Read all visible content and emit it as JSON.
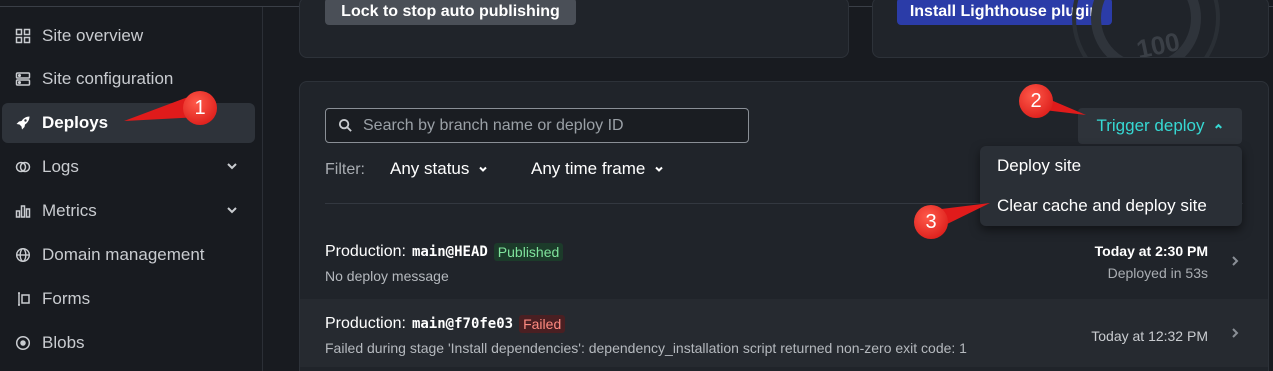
{
  "sidebar": {
    "items": [
      {
        "label": "Site overview",
        "icon": "grid-icon",
        "active": false,
        "has_chevron": false
      },
      {
        "label": "Site configuration",
        "icon": "server-icon",
        "active": false,
        "has_chevron": false
      },
      {
        "label": "Deploys",
        "icon": "rocket-icon",
        "active": true,
        "has_chevron": false
      },
      {
        "label": "Logs",
        "icon": "logs-icon",
        "active": false,
        "has_chevron": true
      },
      {
        "label": "Metrics",
        "icon": "chart-icon",
        "active": false,
        "has_chevron": true
      },
      {
        "label": "Domain management",
        "icon": "globe-icon",
        "active": false,
        "has_chevron": false
      },
      {
        "label": "Forms",
        "icon": "forms-icon",
        "active": false,
        "has_chevron": false
      },
      {
        "label": "Blobs",
        "icon": "blobs-icon",
        "active": false,
        "has_chevron": false
      }
    ]
  },
  "top_cards": {
    "lock_button": "Lock to stop auto publishing",
    "lighthouse_button": "Install Lighthouse plugin",
    "lighthouse_score": "100"
  },
  "deploys": {
    "search_placeholder": "Search by branch name or deploy ID",
    "filter_label": "Filter:",
    "status_filter": "Any status",
    "time_filter": "Any time frame",
    "trigger_label": "Trigger deploy",
    "trigger_menu": [
      "Deploy site",
      "Clear cache and deploy site"
    ],
    "rows": [
      {
        "prefix": "Production:",
        "ref": "main@HEAD",
        "badge": "Published",
        "message": "No deploy message",
        "time": "Today at 2:30 PM",
        "duration": "Deployed in 53s"
      },
      {
        "prefix": "Production:",
        "ref": "main@f70fe03",
        "badge": "Failed",
        "message": "Failed during stage 'Install dependencies': dependency_installation script returned non-zero exit code: 1",
        "time": "Today at 12:32 PM"
      }
    ]
  },
  "annotations": [
    "1",
    "2",
    "3"
  ],
  "colors": {
    "accent_teal": "#36d8d3",
    "primary_blue": "#2b3ca8",
    "callout_red": "#e01b1b",
    "published_green": "#7fe39c",
    "failed_red": "#ff8a80"
  }
}
